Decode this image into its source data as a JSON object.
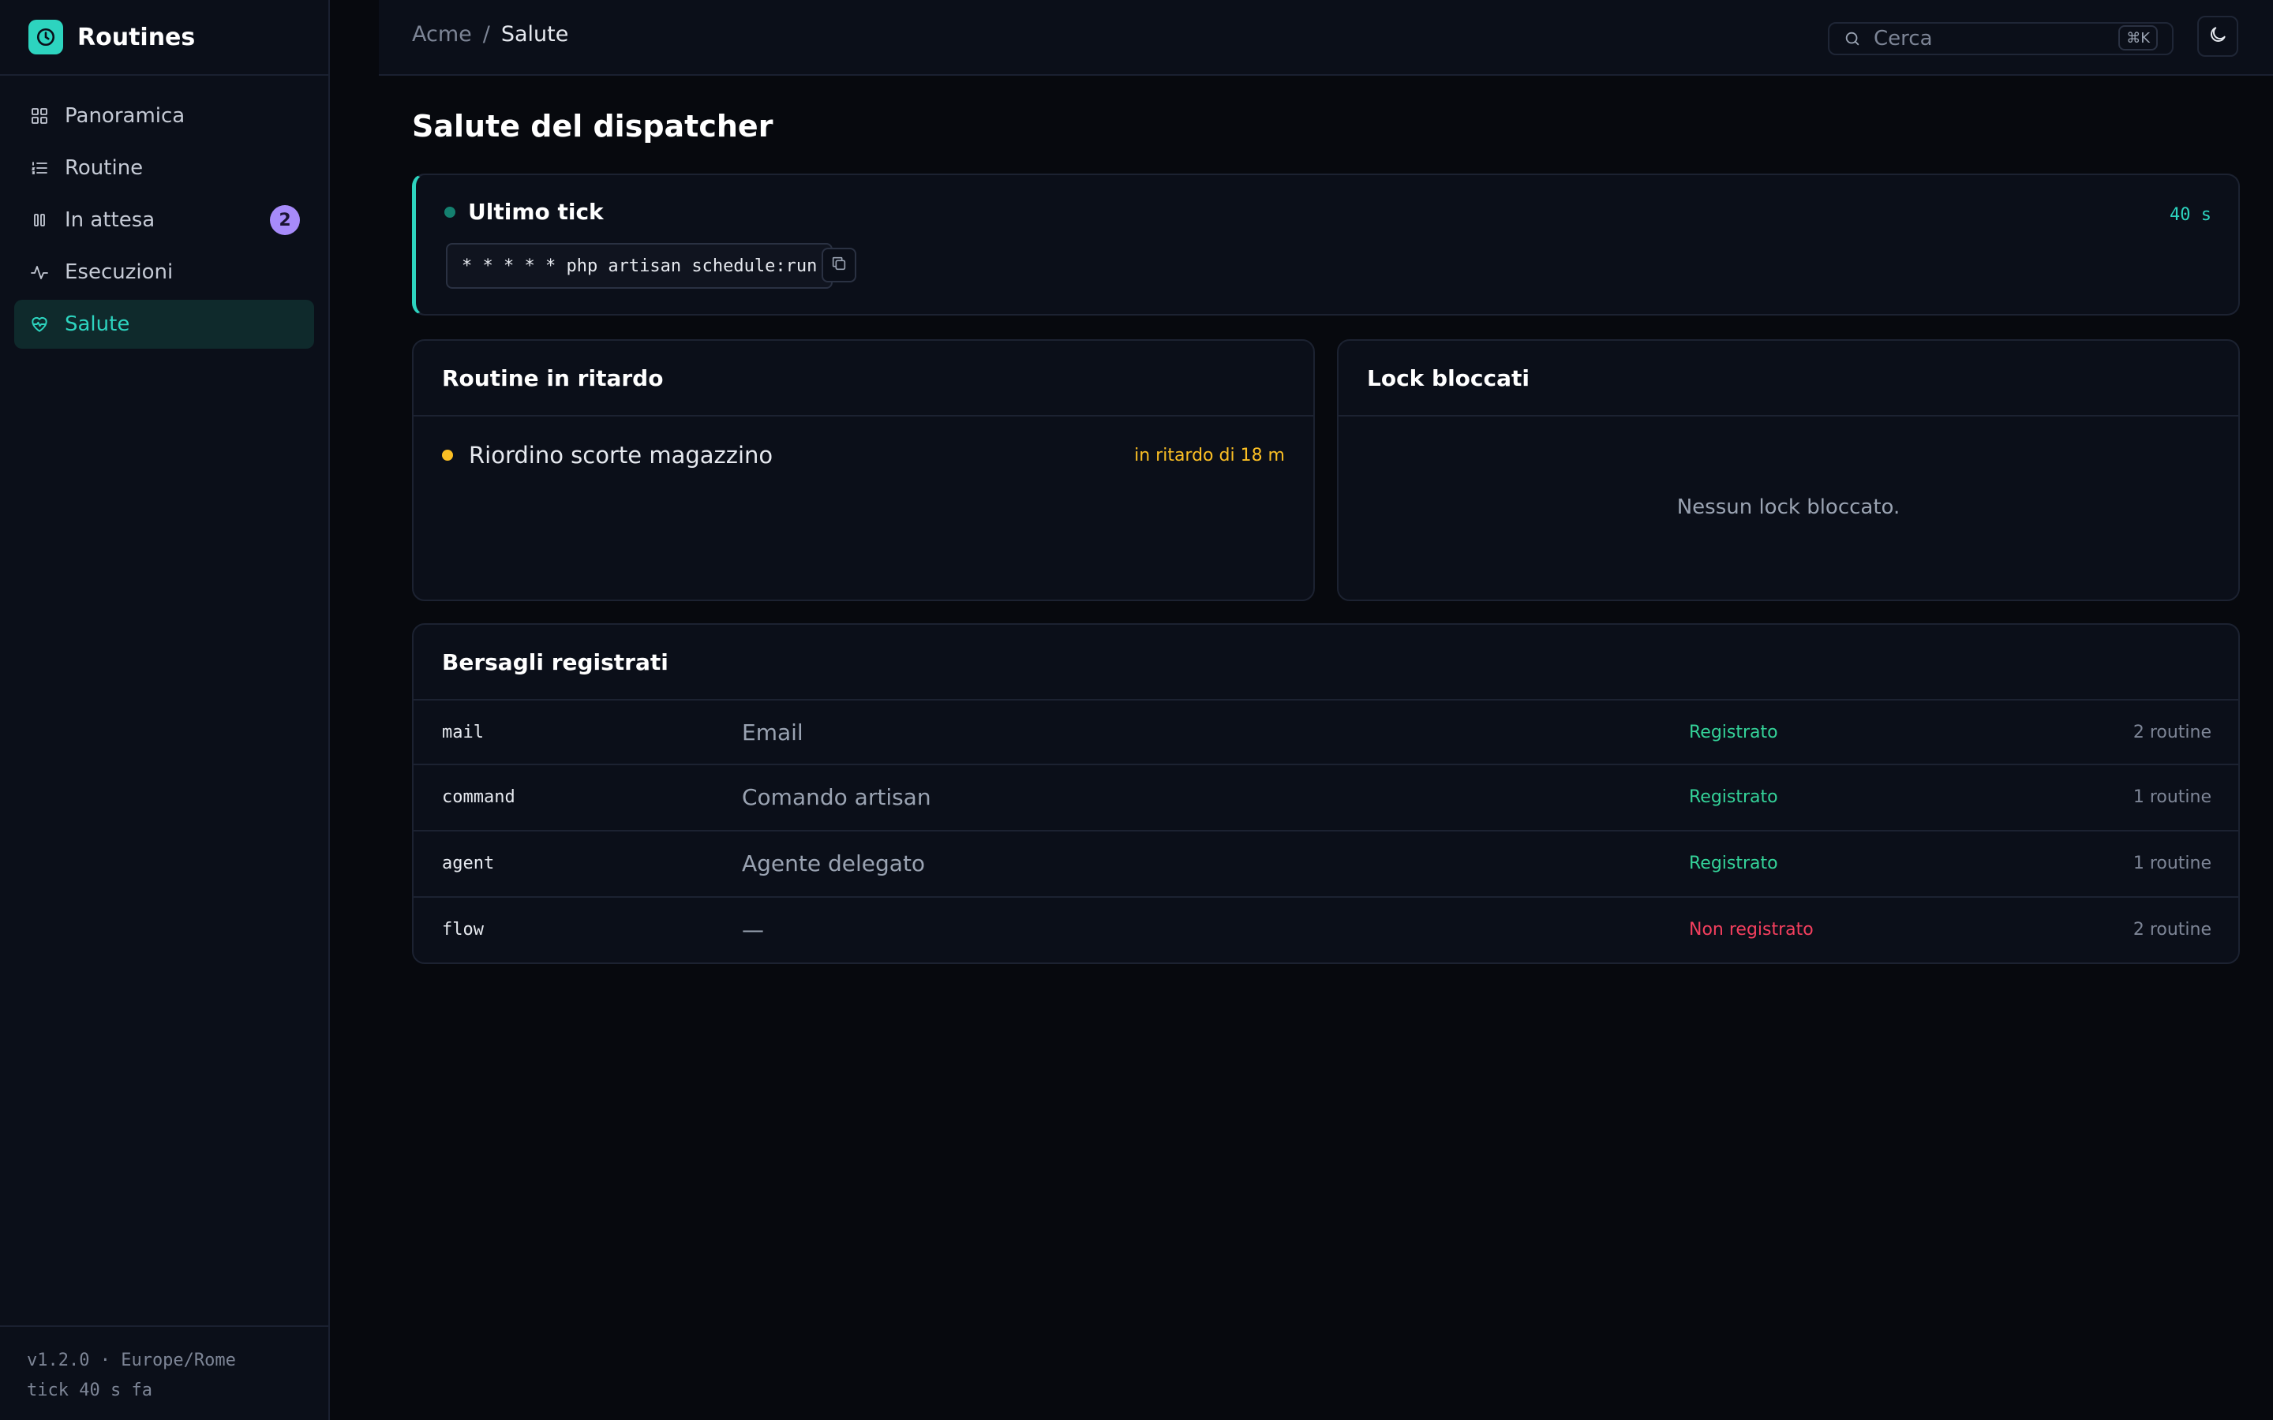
{
  "app": {
    "name": "Routines",
    "logo_icon": "clock-icon",
    "accent": "#2dd4bf"
  },
  "sidebar": {
    "items": [
      {
        "label": "Panoramica",
        "icon": "grid-icon",
        "active": false
      },
      {
        "label": "Routine",
        "icon": "list-icon",
        "active": false
      },
      {
        "label": "In attesa",
        "icon": "pause-icon",
        "active": false,
        "badge": "2"
      },
      {
        "label": "Esecuzioni",
        "icon": "activity-icon",
        "active": false
      },
      {
        "label": "Salute",
        "icon": "heart-pulse-icon",
        "active": true
      }
    ],
    "footer": {
      "line1": "v1.2.0 · Europe/Rome",
      "line2": "tick 40 s fa"
    }
  },
  "header": {
    "breadcrumb": {
      "root": "Acme",
      "separator": "/",
      "current": "Salute"
    },
    "search": {
      "placeholder": "Cerca",
      "shortcut": "⌘K"
    },
    "theme_icon": "moon-icon"
  },
  "page": {
    "title": "Salute del dispatcher"
  },
  "tick": {
    "title": "Ultimo tick",
    "age": "40 s",
    "cron_command": "* * * * * php artisan schedule:run",
    "copy_icon": "copy-icon"
  },
  "late_routines": {
    "title": "Routine in ritardo",
    "items": [
      {
        "name": "Riordino scorte magazzino",
        "status": "in ritardo di 18 m"
      }
    ]
  },
  "locks": {
    "title": "Lock bloccati",
    "empty_message": "Nessun lock bloccato."
  },
  "targets": {
    "title": "Bersagli registrati",
    "rows": [
      {
        "key": "mail",
        "label": "Email",
        "status": "Registrato",
        "registered": true,
        "count": "2 routine"
      },
      {
        "key": "command",
        "label": "Comando artisan",
        "status": "Registrato",
        "registered": true,
        "count": "1 routine"
      },
      {
        "key": "agent",
        "label": "Agente delegato",
        "status": "Registrato",
        "registered": true,
        "count": "1 routine"
      },
      {
        "key": "flow",
        "label": "—",
        "status": "Non registrato",
        "registered": false,
        "count": "2 routine"
      }
    ]
  },
  "colors": {
    "registered": "#34d399",
    "not_registered": "#f43f5e",
    "warning": "#fbbf24",
    "badge": "#a78bfa"
  }
}
